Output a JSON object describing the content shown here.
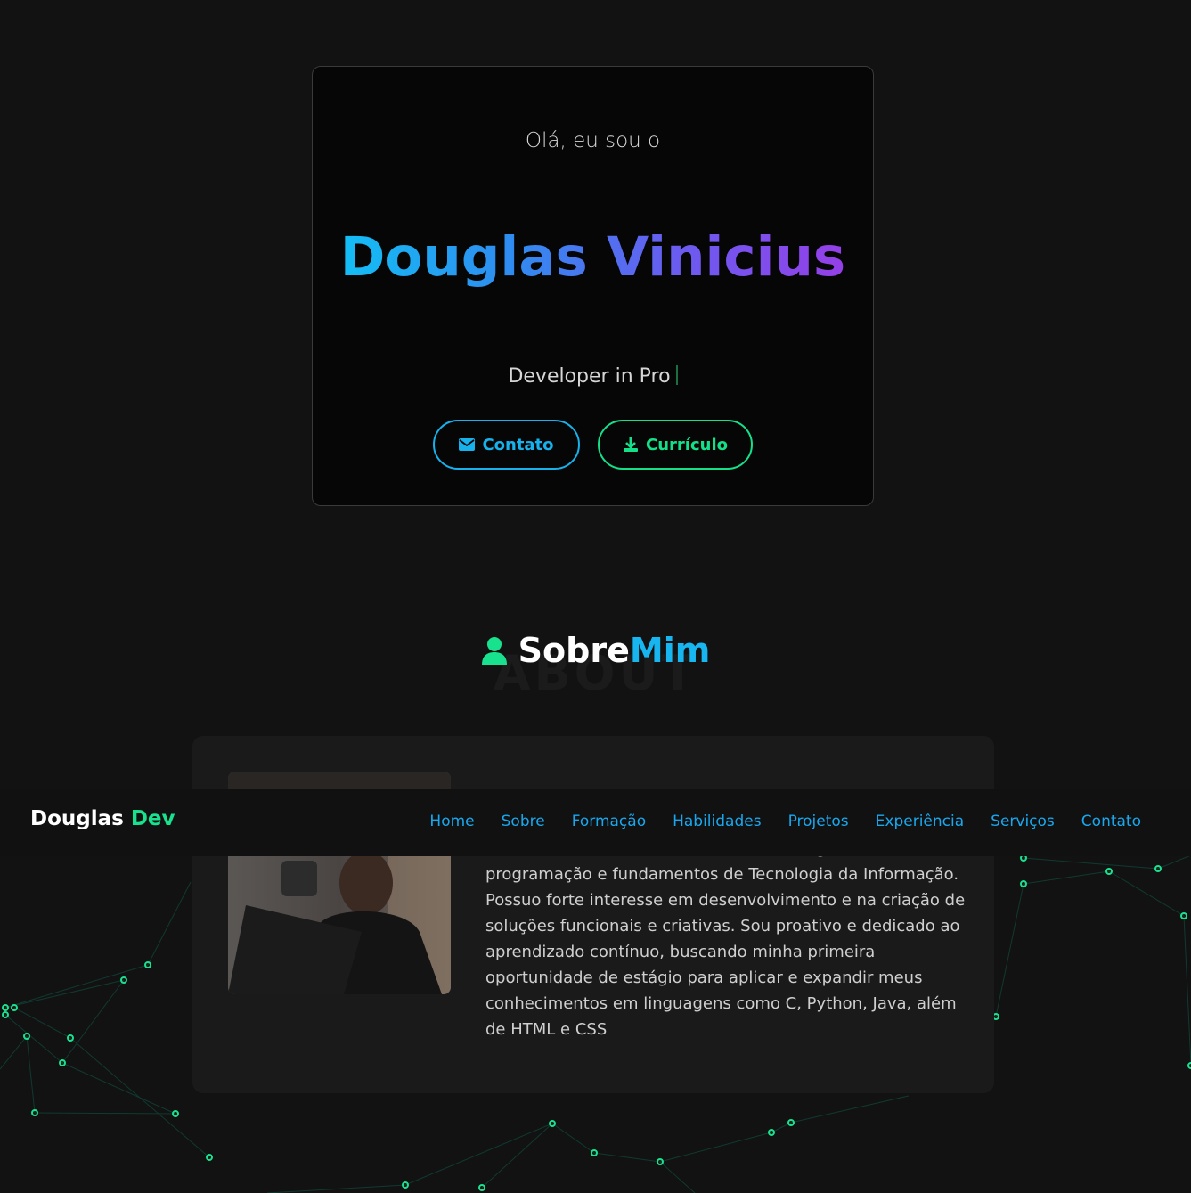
{
  "hero": {
    "greeting": "Olá, eu sou o",
    "name": "Douglas Vinicius",
    "role": "Developer in Pro",
    "buttons": {
      "contact_label": "Contato",
      "cv_label": "Currículo"
    }
  },
  "about": {
    "title_white": "Sobre",
    "title_blue": "Mim",
    "ghost_text": "ABOUT",
    "icon": "user-icon",
    "text": "estou construindo uma base sólida em lógica de programação e fundamentos de Tecnologia da Informação. Possuo forte interesse em desenvolvimento e na criação de soluções funcionais e criativas. Sou proativo e dedicado ao aprendizado contínuo, buscando minha primeira oportunidade de estágio para aplicar e expandir meus conhecimentos em linguagens como C, Python, Java, além de HTML e CSS"
  },
  "navbar": {
    "logo_main": "Douglas",
    "logo_accent": "Dev",
    "links": [
      "Home",
      "Sobre",
      "Formação",
      "Habilidades",
      "Projetos",
      "Experiência",
      "Serviços",
      "Contato"
    ]
  },
  "colors": {
    "accent_green": "#19e28f",
    "accent_blue": "#18b6f0",
    "background": "#121212"
  }
}
